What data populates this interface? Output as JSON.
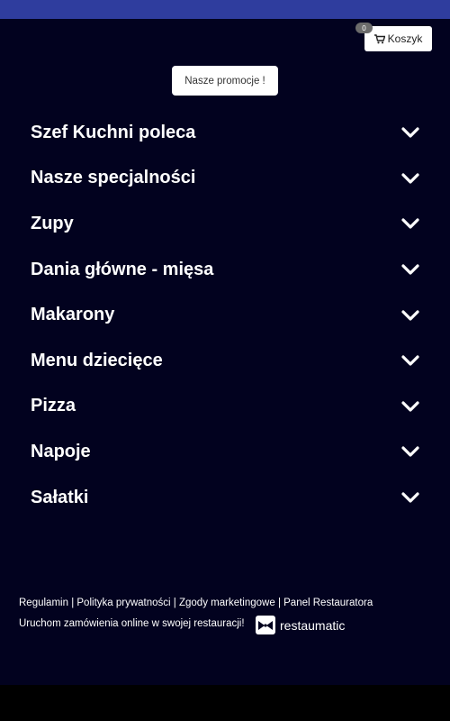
{
  "cart": {
    "label": "Koszyk",
    "count": "0",
    "icon": "cart-icon"
  },
  "promo": {
    "label": "Nasze promocje !"
  },
  "categories": [
    {
      "label": "Szef Kuchni poleca"
    },
    {
      "label": "Nasze specjalności"
    },
    {
      "label": "Zupy"
    },
    {
      "label": "Dania główne - mięsa"
    },
    {
      "label": "Makarony"
    },
    {
      "label": "Menu dziecięce"
    },
    {
      "label": "Pizza"
    },
    {
      "label": "Napoje"
    },
    {
      "label": "Sałatki"
    }
  ],
  "footer": {
    "links": [
      "Regulamin",
      "Polityka prywatności",
      "Zgody marketingowe",
      "Panel Restauratora"
    ],
    "separator": "|",
    "promo_text": "Uruchom zamówienia online w swojej restauracji!",
    "brand": "restaumatic"
  },
  "colors": {
    "background": "#02021f",
    "topbar": "#2f3d9e",
    "text": "#ffffff"
  }
}
